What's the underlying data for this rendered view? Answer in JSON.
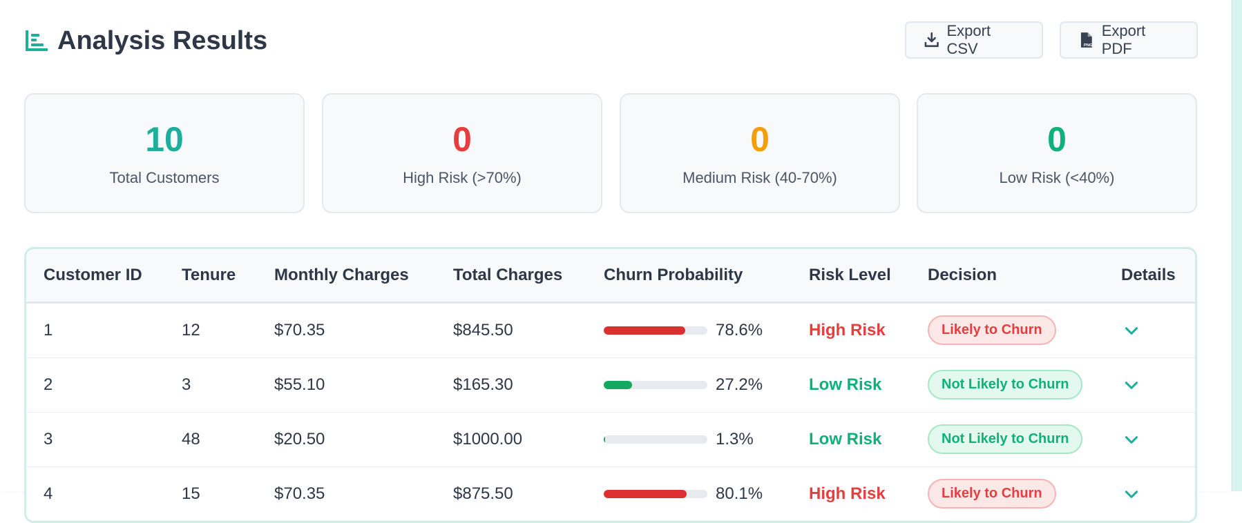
{
  "header": {
    "title": "Analysis Results",
    "title_icon": "bar-chart-icon",
    "export_csv_label": "Export CSV",
    "export_pdf_label": "Export PDF"
  },
  "stats": [
    {
      "value": "10",
      "label": "Total Customers",
      "color": "#1fae9b"
    },
    {
      "value": "0",
      "label": "High Risk (>70%)",
      "color": "#e53e3e"
    },
    {
      "value": "0",
      "label": "Medium Risk (40-70%)",
      "color": "#f59e0b"
    },
    {
      "value": "0",
      "label": "Low Risk (<40%)",
      "color": "#10b07a"
    }
  ],
  "table": {
    "headers": [
      "Customer ID",
      "Tenure",
      "Monthly Charges",
      "Total Charges",
      "Churn Probability",
      "Risk Level",
      "Decision",
      "Details"
    ],
    "rows": [
      {
        "id": "1",
        "tenure": "12",
        "monthly": "$70.35",
        "total": "$845.50",
        "prob": 0.786,
        "prob_label": "78.6%",
        "risk": "High Risk",
        "decision": "Likely to Churn",
        "level": "high"
      },
      {
        "id": "2",
        "tenure": "3",
        "monthly": "$55.10",
        "total": "$165.30",
        "prob": 0.272,
        "prob_label": "27.2%",
        "risk": "Low Risk",
        "decision": "Not Likely to Churn",
        "level": "low"
      },
      {
        "id": "3",
        "tenure": "48",
        "monthly": "$20.50",
        "total": "$1000.00",
        "prob": 0.013,
        "prob_label": "1.3%",
        "risk": "Low Risk",
        "decision": "Not Likely to Churn",
        "level": "low"
      },
      {
        "id": "4",
        "tenure": "15",
        "monthly": "$70.35",
        "total": "$875.50",
        "prob": 0.801,
        "prob_label": "80.1%",
        "risk": "High Risk",
        "decision": "Likely to Churn",
        "level": "high"
      }
    ]
  },
  "colors": {
    "accent": "#1fae9b",
    "high": "#e53e3e",
    "low": "#10b07a",
    "high_bar": "#dc2f2f",
    "low_bar": "#12a860",
    "high_pill_bg": "#fde8e8",
    "high_pill_border": "#f7b3b3",
    "low_pill_bg": "#e3f8ee",
    "low_pill_border": "#a8e6c8"
  }
}
